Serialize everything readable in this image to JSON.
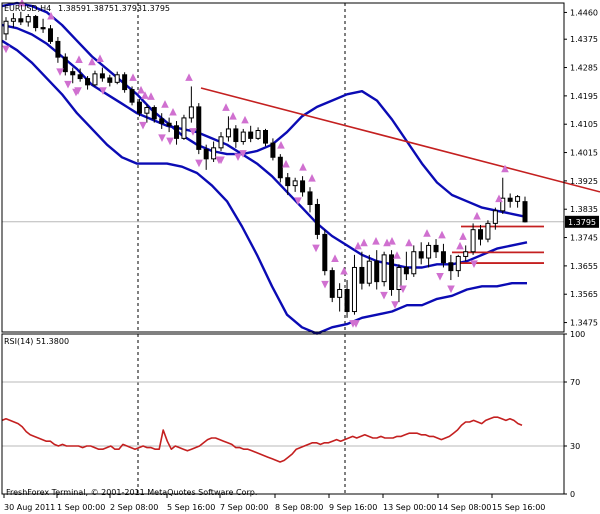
{
  "chart_data": [
    {
      "type": "candlestick",
      "title": "EURUSD,H4",
      "ohlc_readout": [
        "1.3859",
        "1.3875",
        "1.3793",
        "1.3795"
      ],
      "current_price": 1.3795,
      "current_price_label": "1.3795",
      "ylim": [
        1.3445,
        1.449
      ],
      "y_ticks": [
        "1.4460",
        "1.4375",
        "1.4285",
        "1.4195",
        "1.4105",
        "1.4015",
        "1.3925",
        "1.3835",
        "1.3745",
        "1.3655",
        "1.3565",
        "1.3475"
      ],
      "y_tick_values": [
        1.446,
        1.4375,
        1.4285,
        1.4195,
        1.4105,
        1.4015,
        1.3925,
        1.3835,
        1.3745,
        1.3655,
        1.3565,
        1.3475
      ],
      "x_ticks": [
        "30 Aug 2011",
        "1 Sep 00:00",
        "2 Sep 08:00",
        "5 Sep 16:00",
        "7 Sep 00:00",
        "8 Sep 08:00",
        "9 Sep 16:00",
        "13 Sep 00:00",
        "14 Sep 08:00",
        "15 Sep 16:00"
      ],
      "colors": {
        "bull": "#ffffff",
        "bear": "#000000",
        "bands": "#0b0bb4",
        "trend": "#c42020",
        "fractal": "#d070d0",
        "rsi": "#c42020"
      },
      "candles": [
        [
          1.4392,
          1.4445,
          1.4372,
          1.4432
        ],
        [
          1.4432,
          1.4458,
          1.4412,
          1.444
        ],
        [
          1.444,
          1.4462,
          1.442,
          1.443
        ],
        [
          1.443,
          1.4455,
          1.4415,
          1.4447
        ],
        [
          1.4447,
          1.4452,
          1.44,
          1.4412
        ],
        [
          1.4412,
          1.444,
          1.4395,
          1.4408
        ],
        [
          1.4408,
          1.442,
          1.436,
          1.4368
        ],
        [
          1.4368,
          1.4382,
          1.43,
          1.4318
        ],
        [
          1.4318,
          1.433,
          1.426,
          1.4272
        ],
        [
          1.4272,
          1.4285,
          1.4235,
          1.4262
        ],
        [
          1.4262,
          1.4282,
          1.424,
          1.425
        ],
        [
          1.425,
          1.4258,
          1.4215,
          1.423
        ],
        [
          1.423,
          1.4275,
          1.4225,
          1.4265
        ],
        [
          1.4265,
          1.4285,
          1.424,
          1.4252
        ],
        [
          1.4252,
          1.4262,
          1.4225,
          1.4238
        ],
        [
          1.4238,
          1.4272,
          1.4232,
          1.4262
        ],
        [
          1.4262,
          1.427,
          1.4205,
          1.4215
        ],
        [
          1.4215,
          1.4225,
          1.4165,
          1.4175
        ],
        [
          1.4175,
          1.4185,
          1.413,
          1.414
        ],
        [
          1.414,
          1.4168,
          1.411,
          1.4158
        ],
        [
          1.4158,
          1.4165,
          1.411,
          1.4122
        ],
        [
          1.4122,
          1.414,
          1.409,
          1.4108
        ],
        [
          1.4108,
          1.4126,
          1.408,
          1.41
        ],
        [
          1.41,
          1.4115,
          1.404,
          1.406
        ],
        [
          1.406,
          1.4135,
          1.4055,
          1.4125
        ],
        [
          1.4125,
          1.4225,
          1.411,
          1.416
        ],
        [
          1.416,
          1.4172,
          1.401,
          1.4025
        ],
        [
          1.4025,
          1.404,
          1.396,
          1.3995
        ],
        [
          1.3995,
          1.405,
          1.3985,
          1.403
        ],
        [
          1.403,
          1.408,
          1.402,
          1.4065
        ],
        [
          1.4065,
          1.413,
          1.405,
          1.409
        ],
        [
          1.409,
          1.4102,
          1.403,
          1.405
        ],
        [
          1.405,
          1.409,
          1.404,
          1.408
        ],
        [
          1.408,
          1.41,
          1.4048,
          1.406
        ],
        [
          1.406,
          1.4095,
          1.4055,
          1.4085
        ],
        [
          1.4085,
          1.409,
          1.4035,
          1.4045
        ],
        [
          1.4045,
          1.406,
          1.399,
          1.4
        ],
        [
          1.4,
          1.401,
          1.392,
          1.3935
        ],
        [
          1.3935,
          1.395,
          1.388,
          1.391
        ],
        [
          1.391,
          1.3935,
          1.389,
          1.3925
        ],
        [
          1.3925,
          1.394,
          1.3875,
          1.389
        ],
        [
          1.389,
          1.3905,
          1.3825,
          1.385
        ],
        [
          1.385,
          1.3868,
          1.374,
          1.3755
        ],
        [
          1.3755,
          1.377,
          1.3625,
          1.364
        ],
        [
          1.364,
          1.365,
          1.354,
          1.3555
        ],
        [
          1.3555,
          1.36,
          1.351,
          1.358
        ],
        [
          1.358,
          1.361,
          1.349,
          1.351
        ],
        [
          1.351,
          1.369,
          1.35,
          1.365
        ],
        [
          1.365,
          1.37,
          1.358,
          1.36
        ],
        [
          1.36,
          1.369,
          1.359,
          1.367
        ],
        [
          1.367,
          1.3705,
          1.358,
          1.3605
        ],
        [
          1.3605,
          1.37,
          1.359,
          1.369
        ],
        [
          1.369,
          1.3705,
          1.356,
          1.358
        ],
        [
          1.358,
          1.366,
          1.354,
          1.365
        ],
        [
          1.365,
          1.37,
          1.361,
          1.363
        ],
        [
          1.363,
          1.372,
          1.362,
          1.37
        ],
        [
          1.37,
          1.373,
          1.366,
          1.368
        ],
        [
          1.368,
          1.373,
          1.365,
          1.372
        ],
        [
          1.372,
          1.374,
          1.368,
          1.37
        ],
        [
          1.37,
          1.3725,
          1.365,
          1.3665
        ],
        [
          1.3665,
          1.369,
          1.361,
          1.364
        ],
        [
          1.364,
          1.369,
          1.362,
          1.3685
        ],
        [
          1.3685,
          1.372,
          1.367,
          1.37
        ],
        [
          1.37,
          1.379,
          1.369,
          1.377
        ],
        [
          1.377,
          1.3785,
          1.372,
          1.374
        ],
        [
          1.374,
          1.38,
          1.373,
          1.379
        ],
        [
          1.379,
          1.384,
          1.377,
          1.383
        ],
        [
          1.383,
          1.3935,
          1.382,
          1.387
        ],
        [
          1.387,
          1.3885,
          1.384,
          1.386
        ],
        [
          1.386,
          1.388,
          1.384,
          1.3875
        ],
        [
          1.3859,
          1.3875,
          1.3793,
          1.3795
        ]
      ],
      "bollinger_upper": [
        1.448,
        1.449,
        1.448,
        1.446,
        1.442,
        1.437,
        1.432,
        1.428,
        1.424,
        1.42,
        1.415,
        1.411,
        1.407,
        1.404,
        1.402,
        1.401,
        1.401,
        1.402,
        1.404,
        1.408,
        1.413,
        1.416,
        1.418,
        1.42,
        1.421,
        1.418,
        1.412,
        1.405,
        1.398,
        1.392,
        1.388,
        1.386,
        1.384,
        1.383,
        1.382,
        1.381
      ],
      "bollinger_middle": [
        1.442,
        1.441,
        1.439,
        1.436,
        1.432,
        1.428,
        1.423,
        1.42,
        1.417,
        1.414,
        1.412,
        1.41,
        1.409,
        1.408,
        1.406,
        1.404,
        1.401,
        1.398,
        1.394,
        1.389,
        1.384,
        1.379,
        1.375,
        1.372,
        1.369,
        1.367,
        1.366,
        1.365,
        1.365,
        1.366,
        1.366,
        1.367,
        1.369,
        1.371,
        1.372,
        1.373
      ],
      "bollinger_lower": [
        1.437,
        1.434,
        1.43,
        1.425,
        1.42,
        1.414,
        1.409,
        1.404,
        1.4,
        1.398,
        1.398,
        1.398,
        1.397,
        1.395,
        1.391,
        1.386,
        1.378,
        1.369,
        1.359,
        1.35,
        1.346,
        1.344,
        1.346,
        1.347,
        1.349,
        1.35,
        1.351,
        1.353,
        1.353,
        1.355,
        1.356,
        1.358,
        1.359,
        1.359,
        1.36,
        1.36
      ],
      "fractals_up": [
        22,
        51,
        79,
        92,
        100,
        133,
        141,
        145,
        151,
        165,
        173,
        189,
        226,
        233,
        245,
        281,
        286,
        303,
        312,
        335,
        344,
        358,
        364,
        376,
        387,
        392,
        397,
        409,
        427,
        442,
        460,
        463,
        477,
        499,
        505
      ],
      "fractals_down": [
        6,
        60,
        68,
        76,
        78,
        103,
        143,
        162,
        170,
        193,
        199,
        219,
        221,
        238,
        243,
        298,
        316,
        325,
        353,
        356,
        384,
        395,
        403,
        440,
        451,
        474
      ],
      "trendline": [
        [
          201,
          1.422
        ],
        [
          600,
          1.389
        ]
      ],
      "horizontal_levels": [
        [
          461,
          1.378
        ],
        [
          452,
          1.3698
        ],
        [
          459,
          1.3664
        ]
      ]
    },
    {
      "type": "line",
      "title": "RSI(14) 51.3800",
      "ylim": [
        0,
        100
      ],
      "y_ticks": [
        "100",
        "70",
        "30",
        "0"
      ],
      "y_tick_values": [
        100,
        70,
        30,
        0
      ],
      "reference_levels": [
        70,
        30
      ],
      "values": [
        46,
        47,
        46,
        45,
        44,
        42,
        39,
        37,
        36,
        35,
        34,
        33,
        33,
        31,
        30,
        31,
        30,
        30,
        30,
        30,
        29,
        30,
        30,
        29,
        28,
        28,
        29,
        30,
        28,
        28,
        31,
        30,
        29,
        28,
        29,
        30,
        29,
        29,
        28,
        28,
        40,
        33,
        28,
        30,
        29,
        28,
        27,
        28,
        29,
        30,
        32,
        34,
        35,
        35,
        34,
        33,
        32,
        31,
        29,
        29,
        28,
        28,
        27,
        26,
        25,
        24,
        23,
        22,
        21,
        20,
        21,
        23,
        25,
        28,
        29,
        30,
        31,
        32,
        32,
        31,
        32,
        32,
        33,
        34,
        33,
        34,
        35,
        36,
        35,
        36,
        37,
        36,
        35,
        35,
        36,
        35,
        35,
        35,
        36,
        36,
        37,
        38,
        38,
        38,
        37,
        37,
        36,
        36,
        35,
        34,
        35,
        36,
        38,
        40,
        43,
        45,
        45,
        46,
        45,
        44,
        46,
        47,
        48,
        48,
        47,
        46,
        47,
        46,
        44,
        43
      ]
    }
  ],
  "footer": {
    "copyright": "FreshForex Terminal, © 2001-2011 MetaQuotes Software Corp."
  }
}
